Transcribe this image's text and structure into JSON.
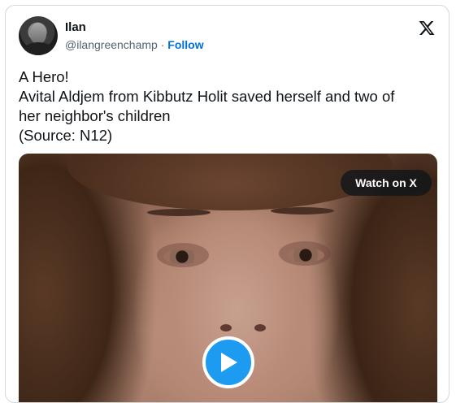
{
  "author": {
    "name": "Ilan",
    "handle": "@ilangreenchamp",
    "separator": "·",
    "follow_label": "Follow"
  },
  "brand_icon": "x-logo-icon",
  "tweet": {
    "lines": [
      "A Hero!",
      "Avital Aldjem from Kibbutz Holit saved herself and two of",
      "her neighbor's children",
      "(Source: N12)"
    ]
  },
  "media": {
    "watch_label": "Watch on X",
    "play_icon": "play-icon"
  },
  "colors": {
    "accent": "#1d9bf0",
    "follow": "#006fd6",
    "text": "#0f1419",
    "secondary_text": "#536471",
    "border": "#cfd9de"
  }
}
